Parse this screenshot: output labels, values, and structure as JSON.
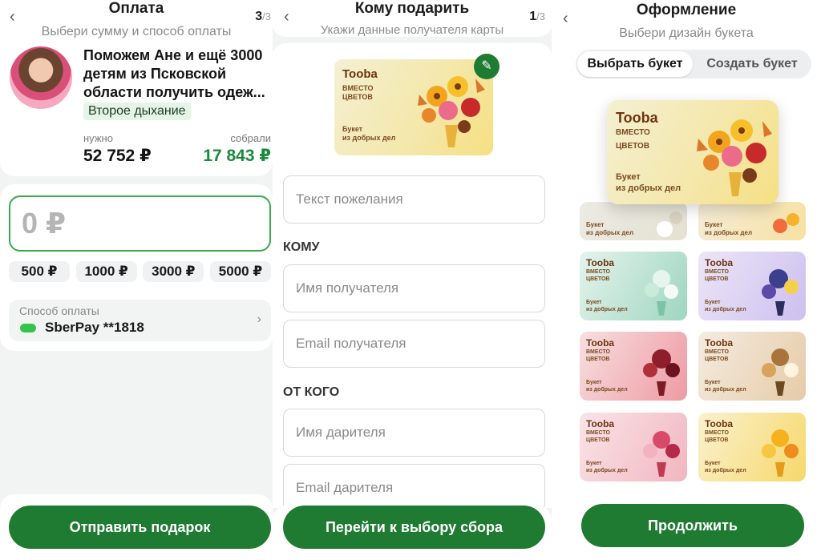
{
  "payment": {
    "title": "Оплата",
    "subtitle": "Выбери сумму и способ оплаты",
    "step_current": "3",
    "step_total": "/3",
    "fund_title": "Поможем Ане и ещё 3000 детям из Псковской области получить одеж...",
    "fund_tag": "Второе дыхание",
    "need_label": "нужно",
    "need_value": "52 752 ₽",
    "collected_label": "собрали",
    "collected_value": "17 843 ₽",
    "amount_value": "0 ₽",
    "amount_chips": [
      "500 ₽",
      "1000 ₽",
      "3000 ₽",
      "5000 ₽"
    ],
    "payment_method_label": "Способ оплаты",
    "payment_method_value": "SberPay **1818",
    "submit_label": "Отправить подарок"
  },
  "recipient": {
    "title": "Кому подарить",
    "subtitle": "Укажи данные получателя карты",
    "step_current": "1",
    "step_total": "/3",
    "wish_placeholder": "Текст пожелания",
    "to_label": "КОМУ",
    "recipient_name_placeholder": "Имя получателя",
    "recipient_email_placeholder": "Email  получателя",
    "from_label": "ОТ КОГО",
    "sender_name_placeholder": "Имя дарителя",
    "sender_email_placeholder": "Email дарителя",
    "submit_label": "Перейти к выбору сбора"
  },
  "design": {
    "title": "Оформление",
    "subtitle": "Выбери дизайн букета",
    "tab_choose": "Выбрать букет",
    "tab_create": "Создать букет",
    "submit_label": "Продолжить"
  },
  "card": {
    "brand": "Tooba",
    "line1": "ВМЕСТО",
    "line2": "ЦВЕТОВ",
    "line3": "Букет",
    "line4": "из добрых дел"
  },
  "colors": {
    "accent": "#1f7a32",
    "collected": "#1a8a3a",
    "tag_bg": "#e4f4e7"
  }
}
